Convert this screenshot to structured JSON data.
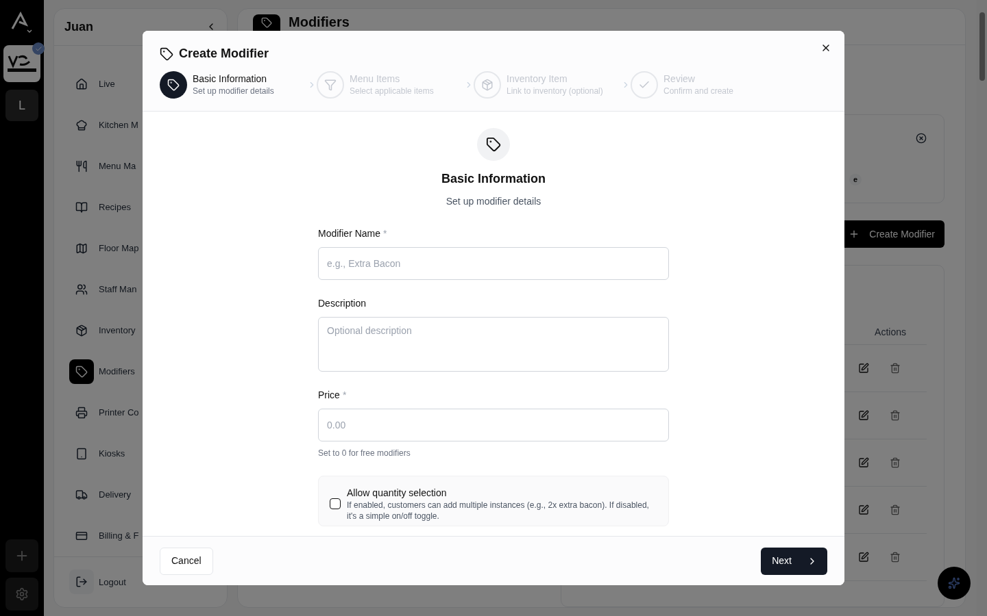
{
  "rail": {
    "workspace_initial": "L"
  },
  "sidebar": {
    "user": "Juan",
    "items": [
      {
        "label": "Live",
        "selected": false
      },
      {
        "label": "Kitchen M",
        "selected": false
      },
      {
        "label": "Menu Ma",
        "selected": false
      },
      {
        "label": "Recipes",
        "selected": false
      },
      {
        "label": "Floor Map",
        "selected": false
      },
      {
        "label": "Staff Man",
        "selected": false
      },
      {
        "label": "Inventory",
        "selected": false
      },
      {
        "label": "Modifiers",
        "selected": true
      },
      {
        "label": "Printer Co",
        "selected": false
      },
      {
        "label": "Kiosks",
        "selected": false
      },
      {
        "label": "Delivery",
        "selected": false
      },
      {
        "label": "Billing & F",
        "selected": false
      }
    ],
    "logout": "Logout"
  },
  "page": {
    "title": "Modifiers",
    "filter_badge": "e",
    "create_button": "Create Modifier",
    "table": {
      "columns": [
        "Actions"
      ],
      "rows": [
        {
          "kind": "actions"
        },
        {
          "kind": "actions"
        },
        {
          "kind": "actions"
        },
        {
          "kind": "actions"
        },
        {
          "kind": "actions"
        }
      ]
    }
  },
  "modal": {
    "title": "Create Modifier",
    "steps": [
      {
        "title": "Basic Information",
        "subtitle": "Set up modifier details",
        "selected": true
      },
      {
        "title": "Menu Items",
        "subtitle": "Select applicable items",
        "selected": false
      },
      {
        "title": "Inventory Item",
        "subtitle": "Link to inventory (optional)",
        "selected": false
      },
      {
        "title": "Review",
        "subtitle": "Confirm and create",
        "selected": false
      }
    ],
    "section": {
      "title": "Basic Information",
      "subtitle": "Set up modifier details"
    },
    "fields": [
      {
        "kind": "input",
        "label": "Modifier Name",
        "required_mark": "*",
        "placeholder": "e.g., Extra Bacon"
      },
      {
        "kind": "textarea",
        "label": "Description",
        "placeholder": "Optional description"
      },
      {
        "kind": "input",
        "label": "Price",
        "required_mark": "*",
        "placeholder": "0.00",
        "hint": "Set to 0 for free modifiers"
      }
    ],
    "option": {
      "label": "Allow quantity selection",
      "description": "If enabled, customers can add multiple instances (e.g., 2x extra bacon). If disabled, it's a simple on/off toggle.",
      "checked": false
    },
    "cancel": "Cancel",
    "next": "Next"
  }
}
